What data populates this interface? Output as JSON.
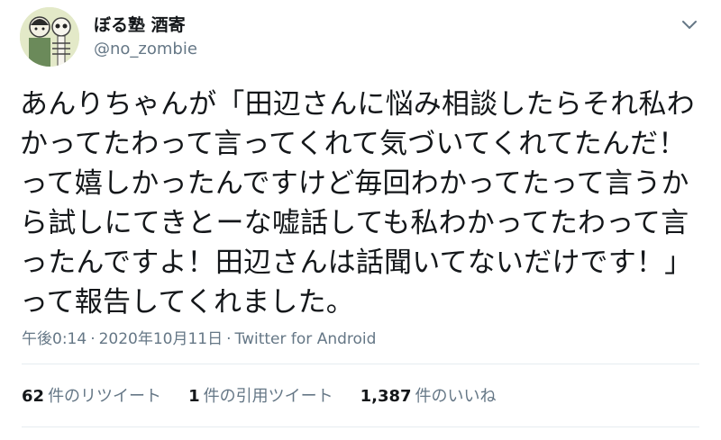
{
  "user": {
    "name": "ぼる塾 酒寄",
    "handle": "@no_zombie"
  },
  "tweet": {
    "lines": [
      "あんりちゃんが「田辺さんに悩み相談したらそれ私わ",
      "かってたわって言ってくれて気づいてくれてたんだ！",
      "って嬉しかったんですけど毎回わかってたって言うか",
      "ら試しにてきとーな嘘話しても私わかってたわって言",
      "ったんですよ！田辺さんは話聞いてないだけです！」",
      "って報告してくれました。"
    ]
  },
  "meta": {
    "time": "午後0:14",
    "separator": "·",
    "date": "2020年10月11日",
    "source": "Twitter for Android"
  },
  "stats": {
    "retweets_count": "62",
    "retweets_label": "件のリツイート",
    "quotes_count": "1",
    "quotes_label": "件の引用ツイート",
    "likes_count": "1,387",
    "likes_label": "件のいいね"
  },
  "icons": {
    "avatar": "avatar-illustration",
    "caret": "chevron-down-icon"
  },
  "colors": {
    "text": "#14171a",
    "secondary": "#657786",
    "divider": "#e6ecf0"
  }
}
